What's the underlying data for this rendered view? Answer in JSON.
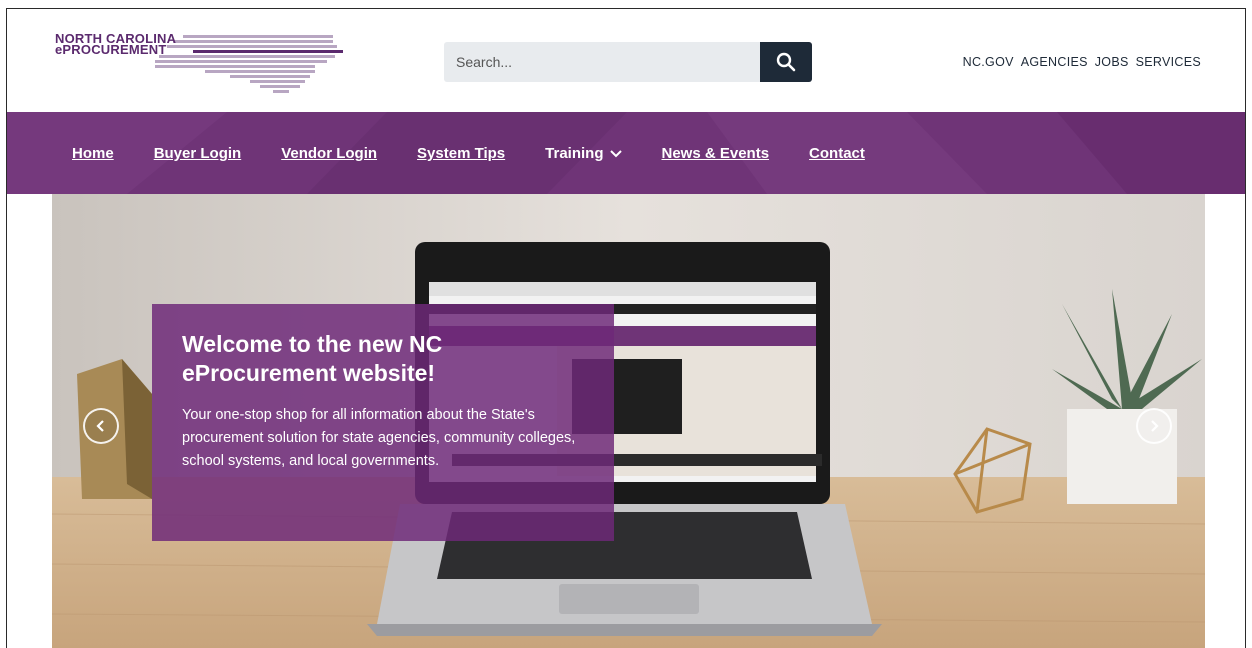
{
  "logo": {
    "line1": "NORTH CAROLINA",
    "line2": "ePROCUREMENT"
  },
  "search": {
    "placeholder": "Search..."
  },
  "utility_nav": [
    {
      "label": "NC.GOV"
    },
    {
      "label": "AGENCIES"
    },
    {
      "label": "JOBS"
    },
    {
      "label": "SERVICES"
    }
  ],
  "main_nav": [
    {
      "label": "Home"
    },
    {
      "label": "Buyer Login"
    },
    {
      "label": "Vendor Login"
    },
    {
      "label": "System Tips"
    },
    {
      "label": "Training",
      "dropdown": true
    },
    {
      "label": "News & Events"
    },
    {
      "label": "Contact"
    }
  ],
  "hero": {
    "heading": "Welcome to the new NC eProcurement website!",
    "body": "Your one-stop shop for all information about the State's procurement solution for state agencies, community colleges, school systems, and local governments."
  },
  "colors": {
    "brand_purple": "#6f3477",
    "search_button": "#1e2a38",
    "util_text": "#1e2a38"
  },
  "icons": {
    "search": "search-icon",
    "dropdown": "chevron-down-icon",
    "prev": "chevron-left-icon",
    "next": "chevron-right-icon"
  }
}
